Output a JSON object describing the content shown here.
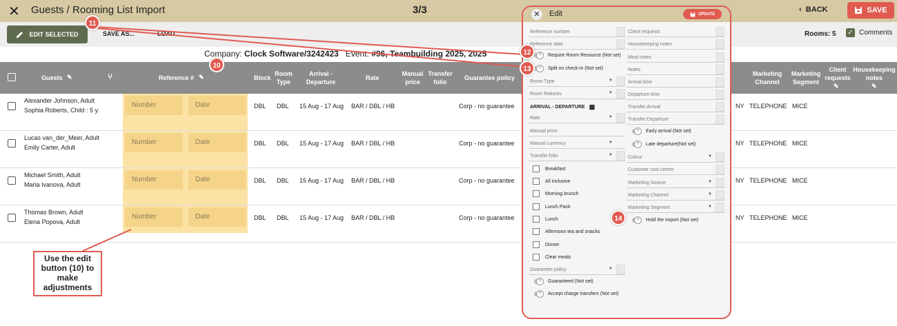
{
  "topbar": {
    "close_label": "✕",
    "title": "Guests / Rooming List Import",
    "step": "3/3",
    "back_label": "BACK",
    "save_label": "SAVE"
  },
  "toolbar": {
    "edit_selected_label": "EDIT SELECTED",
    "save_as_label": "SAVE AS...",
    "load_label": "LOAD",
    "rooms_label": "Rooms: 5",
    "comments_label": "Comments"
  },
  "company": {
    "company_prefix": "Company:",
    "company_value": "Clock Software/3242423",
    "event_prefix": "Event:",
    "event_value": "#96, Teambuilding 2025, 2025"
  },
  "table": {
    "headers": {
      "guests": "Guests",
      "reference": "Reference #",
      "block": "Block",
      "room_type": "Room Type",
      "arrival": "Arrival - Departure",
      "rate": "Rate",
      "manual_price": "Manual price",
      "transfer_folio": "Transfer folio",
      "guarantee": "Guarantee policy",
      "marketing_channel": "Marketing Channel",
      "marketing_segment": "Marketing Segment",
      "client_requests": "Client requests",
      "housekeeping": "Housekeeping notes"
    },
    "rows": [
      {
        "guest1": "Alexander Johnson, Adult",
        "guest2": "Sophia Roberts, Child : 5 y.",
        "number_ph": "Number",
        "date_ph": "Date",
        "block": "DBL",
        "room": "DBL",
        "dates": "15 Aug - 17 Aug",
        "rate": "BAR / DBL / HB",
        "guarantee": "Corp - no guarantee",
        "cost_centre": "NY",
        "channel": "TELEPHONE",
        "segment": "MICE"
      },
      {
        "guest1": "Lucas van_der_Meer, Adult",
        "guest2": "Emily Carter, Adult",
        "number_ph": "Number",
        "date_ph": "Date",
        "block": "DBL",
        "room": "DBL",
        "dates": "15 Aug - 17 Aug",
        "rate": "BAR / DBL / HB",
        "guarantee": "Corp - no guarantee",
        "cost_centre": "NY",
        "channel": "TELEPHONE",
        "segment": "MICE"
      },
      {
        "guest1": "Michael Smith, Adult",
        "guest2": "Maria Ivanova, Adult",
        "number_ph": "Number",
        "date_ph": "Date",
        "block": "DBL",
        "room": "DBL",
        "dates": "15 Aug - 17 Aug",
        "rate": "BAR / DBL / HB",
        "guarantee": "Corp - no guarantee",
        "cost_centre": "NY",
        "channel": "TELEPHONE",
        "segment": "MICE"
      },
      {
        "guest1": "Thomas Brown, Adult",
        "guest2": "Elena Popova, Adult",
        "number_ph": "Number",
        "date_ph": "Date",
        "block": "DBL",
        "room": "DBL",
        "dates": "15 Aug - 17 Aug",
        "rate": "BAR / DBL / HB",
        "guarantee": "Corp - no guarantee",
        "cost_centre": "NY",
        "channel": "TELEPHONE",
        "segment": "MICE"
      }
    ]
  },
  "panel": {
    "title": "Edit",
    "update_label": "UPDATE",
    "left_fields": [
      "Reference number",
      "Reference date"
    ],
    "toggle_room_resource": "Require Room Resource (Not set)",
    "toggle_split": "Split on check-in (Not set)",
    "room_type": "Room Type",
    "room_features": "Room features",
    "arrival_departure": "ARRIVAL - DEPARTURE",
    "rate": "Rate",
    "manual_price": "Manual price",
    "manual_currency": "Manual currency",
    "transfer_folio": "Transfer folio",
    "meals": [
      "Breakfast",
      "All inclusive",
      "Morning brunch",
      "Lunch Pack",
      "Lunch",
      "Afternoon tea and snacks",
      "Dinner",
      "Clear meals"
    ],
    "guarantee_policy": "Guarantee policy",
    "toggle_guaranteed": "Guaranteed (Not set)",
    "toggle_charge": "Accept charge transfers (Not set)",
    "right_fields": [
      "Client requests",
      "Housekeeping notes",
      "Meal notes",
      "Notes",
      "Arrival time",
      "Departure time",
      "Transfer Arrival",
      "Transfer Departure"
    ],
    "toggle_early": "Early arrival (Not set)",
    "toggle_late": "Late departure(Not set)",
    "right_dropdowns": [
      "Colour",
      "Customer cost centre",
      "Marketing Source",
      "Marketing Channel",
      "Marketing Segment"
    ],
    "toggle_hold": "Hold the import (Not set)"
  },
  "callouts": {
    "b10": "10",
    "b11": "11",
    "b12": "12",
    "b13": "13",
    "b14": "14",
    "note": "Use the edit button (10) to make adjustments"
  },
  "colors": {
    "accent": "#e05a50",
    "topbar": "#d6c9a3",
    "header": "#8c8c8c",
    "edit_button": "#5f6b4e",
    "ref_highlight": "#fbe3a6"
  }
}
